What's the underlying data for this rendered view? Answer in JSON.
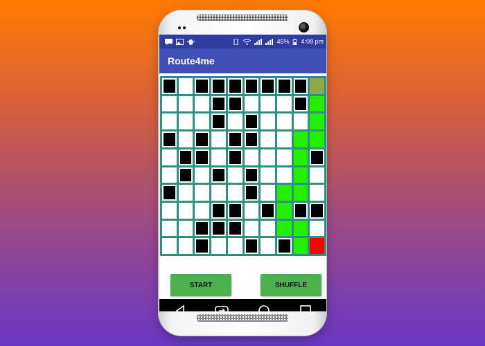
{
  "status_bar": {
    "battery_percent": "45%",
    "time": "4:08 pm"
  },
  "app": {
    "title": "Route4me"
  },
  "grid": {
    "rows": 10,
    "cols": 10,
    "cells": [
      [
        "obstacle",
        "empty",
        "obstacle",
        "obstacle",
        "obstacle",
        "obstacle",
        "obstacle",
        "obstacle",
        "obstacle",
        "start"
      ],
      [
        "empty",
        "empty",
        "empty",
        "obstacle",
        "obstacle",
        "empty",
        "empty",
        "empty",
        "obstacle",
        "path"
      ],
      [
        "empty",
        "empty",
        "empty",
        "obstacle",
        "empty",
        "obstacle",
        "empty",
        "empty",
        "empty",
        "path"
      ],
      [
        "obstacle",
        "empty",
        "obstacle",
        "empty",
        "obstacle",
        "obstacle",
        "empty",
        "empty",
        "path",
        "path"
      ],
      [
        "empty",
        "obstacle",
        "obstacle",
        "empty",
        "obstacle",
        "empty",
        "empty",
        "empty",
        "path",
        "obstacle"
      ],
      [
        "empty",
        "obstacle",
        "empty",
        "obstacle",
        "empty",
        "obstacle",
        "empty",
        "empty",
        "path",
        "empty"
      ],
      [
        "obstacle",
        "empty",
        "empty",
        "empty",
        "empty",
        "obstacle",
        "empty",
        "path",
        "path",
        "empty"
      ],
      [
        "empty",
        "empty",
        "empty",
        "obstacle",
        "obstacle",
        "empty",
        "obstacle",
        "path",
        "obstacle",
        "obstacle"
      ],
      [
        "empty",
        "empty",
        "obstacle",
        "obstacle",
        "obstacle",
        "empty",
        "empty",
        "path",
        "path",
        "empty"
      ],
      [
        "empty",
        "empty",
        "obstacle",
        "empty",
        "empty",
        "obstacle",
        "empty",
        "obstacle",
        "path",
        "goal"
      ]
    ]
  },
  "buttons": {
    "start_label": "START",
    "shuffle_label": "SHUFFLE"
  },
  "colors": {
    "status_bar": "#2f3e9e",
    "app_bar": "#3f51b5",
    "grid_line": "#2f8f80",
    "path": "#22ee00",
    "start": "#8fa64b",
    "goal": "#ff0000",
    "button": "#4caf50"
  },
  "icons": {
    "status_left": [
      "message-icon",
      "image-icon",
      "bug-icon"
    ],
    "status_right": [
      "vibrate-icon",
      "wifi-icon",
      "signal-icon",
      "signal-icon",
      "battery-icon"
    ],
    "nav": [
      "back-icon",
      "recent-apps-icon",
      "home-icon",
      "overview-icon"
    ]
  }
}
